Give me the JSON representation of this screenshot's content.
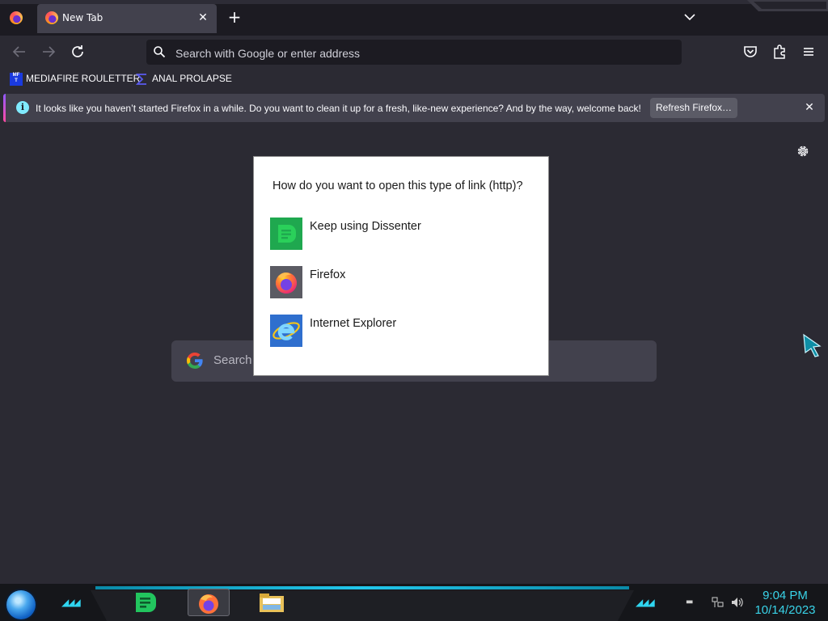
{
  "tabstrip": {
    "tab_title": "New Tab",
    "new_tab_label": "+"
  },
  "navbar": {
    "url_placeholder": "Search with Google or enter address"
  },
  "bookmarks": [
    {
      "label": "MEDIAFIRE ROULETTER",
      "icon": "mediafire-icon"
    },
    {
      "label": "ANAL PROLAPSE",
      "icon": "sigma-icon"
    }
  ],
  "notification": {
    "message": "It looks like you haven’t started Firefox in a while. Do you want to clean it up for a fresh, like-new experience? And by the way, welcome back!",
    "button_label": "Refresh Firefox…"
  },
  "ntp": {
    "search_placeholder": "Search"
  },
  "dialog": {
    "question": "How do you want to open this type of link (http)?",
    "options": [
      {
        "label": "Keep using Dissenter",
        "icon": "dissenter-icon"
      },
      {
        "label": "Firefox",
        "icon": "firefox-icon"
      },
      {
        "label": "Internet Explorer",
        "icon": "internet-explorer-icon"
      }
    ]
  },
  "taskbar": {
    "time": "9:04 PM",
    "date": "10/14/2023"
  },
  "colors": {
    "browser_bg": "#2b2a33",
    "tabstrip_bg": "#1c1b22",
    "accent_cyan": "#39d3e8",
    "dissenter_green": "#1fa84f"
  }
}
